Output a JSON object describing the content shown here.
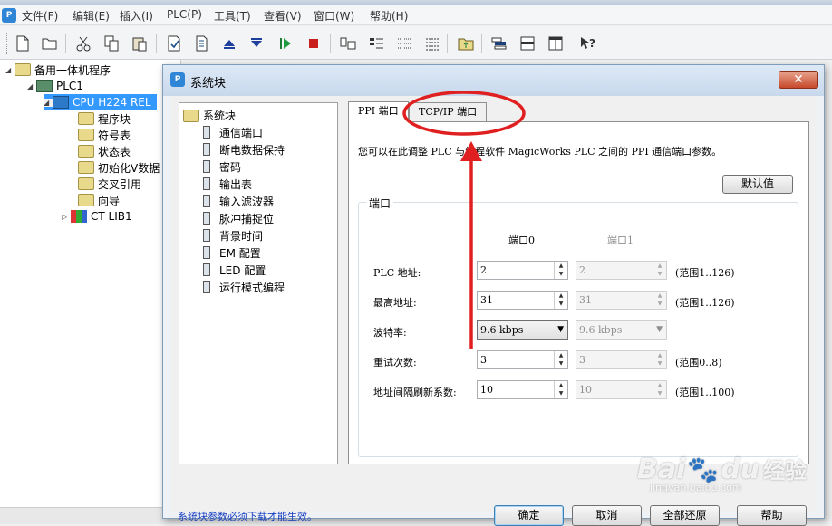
{
  "menu": [
    "文件(F)",
    "编辑(E)",
    "插入(I)",
    "PLC(P)",
    "工具(T)",
    "查看(V)",
    "窗口(W)",
    "帮助(H)"
  ],
  "toolbar_icons": [
    "new-file-icon",
    "open-folder-icon",
    "cut-icon",
    "copy-icon",
    "paste-icon",
    "compile-icon",
    "compile-all-icon",
    "upload-icon",
    "download-icon",
    "run-icon",
    "stop-icon",
    "status-chart-icon",
    "ladder-icon",
    "fbd-icon",
    "stl-icon",
    "system-block-icon",
    "cross-ref-icon",
    "data-block-icon",
    "window-split-icon",
    "help-pointer-icon"
  ],
  "tree": {
    "root": "备用一体机程序",
    "plc": "PLC1",
    "cpu": "CPU H224 REL",
    "children": [
      "程序块",
      "符号表",
      "状态表",
      "初始化V数据",
      "交叉引用",
      "向导"
    ],
    "lib": "CT LIB1"
  },
  "dialog": {
    "title": "系统块",
    "close": "✕",
    "nav_root": "系统块",
    "nav_items": [
      "通信端口",
      "断电数据保持",
      "密码",
      "输出表",
      "输入滤波器",
      "脉冲捕捉位",
      "背景时间",
      "EM 配置",
      "LED 配置",
      "运行模式编程"
    ],
    "tabs": [
      "PPI 端口",
      "TCP/IP 端口"
    ],
    "description": "您可以在此调整 PLC 与编程软件 MagicWorks PLC 之间的 PPI 通信端口参数。",
    "default_button": "默认值",
    "group_label": "端口",
    "col0": "端口0",
    "col1": "端口1",
    "rows": [
      {
        "label": "PLC 地址:",
        "v0": "2",
        "v1": "2",
        "range": "(范围1..126)"
      },
      {
        "label": "最高地址:",
        "v0": "31",
        "v1": "31",
        "range": "(范围1..126)"
      },
      {
        "label": "波特率:",
        "v0": "9.6 kbps",
        "v1": "9.6 kbps",
        "range": ""
      },
      {
        "label": "重试次数:",
        "v0": "3",
        "v1": "3",
        "range": "(范围0..8)"
      },
      {
        "label": "地址间隔刷新系数:",
        "v0": "10",
        "v1": "10",
        "range": "(范围1..100)"
      }
    ],
    "footer_note": "系统块参数必须下载才能生效。",
    "buttons": {
      "ok": "确定",
      "cancel": "取消",
      "restore": "全部还原",
      "help": "帮助"
    }
  },
  "watermark": {
    "brand": "Bai",
    "paw": "du",
    "suffix": "经验",
    "url": "jingyan.baidu.com"
  },
  "colors": {
    "annotation": "#e02020",
    "selection": "#3399ff",
    "link": "#1a3fbf"
  }
}
